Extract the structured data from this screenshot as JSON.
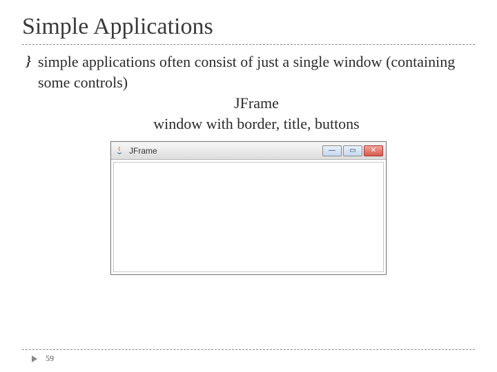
{
  "title": "Simple Applications",
  "bullet": {
    "mark": "}",
    "line1": "simple applications often consist of just a single window (containing some controls)",
    "line2": "JFrame",
    "line3": "window with border, title, buttons"
  },
  "jframe": {
    "title": "JFrame",
    "min_glyph": "—",
    "max_glyph": "▭",
    "close_glyph": "✕"
  },
  "page_number": "59"
}
